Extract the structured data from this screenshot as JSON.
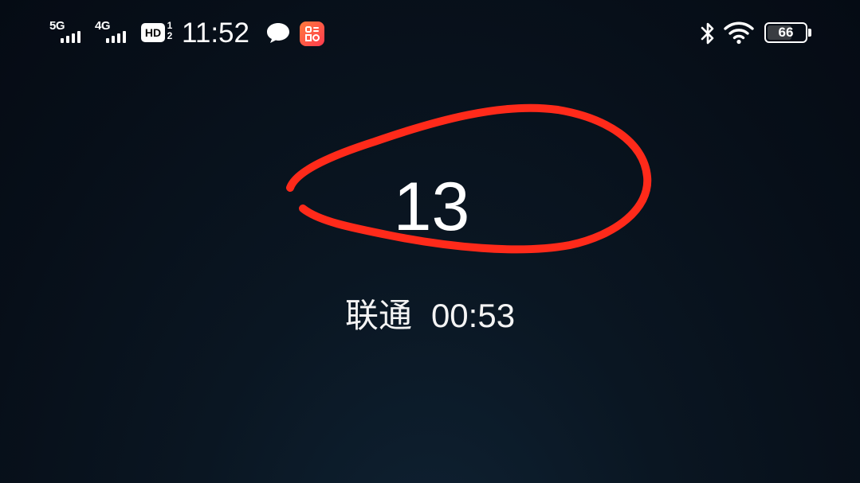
{
  "status_bar": {
    "sim1": {
      "network": "5G",
      "signal_bars": 4
    },
    "sim2": {
      "network": "4G",
      "signal_bars": 4
    },
    "hd_badge": "HD",
    "hd_top": "1",
    "hd_bottom": "2",
    "time": "11:52",
    "notification_icons": [
      "chat-bubble-icon",
      "app-notification-icon"
    ],
    "right_icons": [
      "bluetooth-icon",
      "wifi-icon",
      "battery-icon"
    ],
    "battery_level": "66",
    "battery_fraction": 0.66
  },
  "call": {
    "number": "13",
    "carrier": "联通",
    "duration": "00:53"
  },
  "annotation": {
    "shape": "freehand-ellipse",
    "color": "#ff2a1a",
    "target": "call-number"
  }
}
